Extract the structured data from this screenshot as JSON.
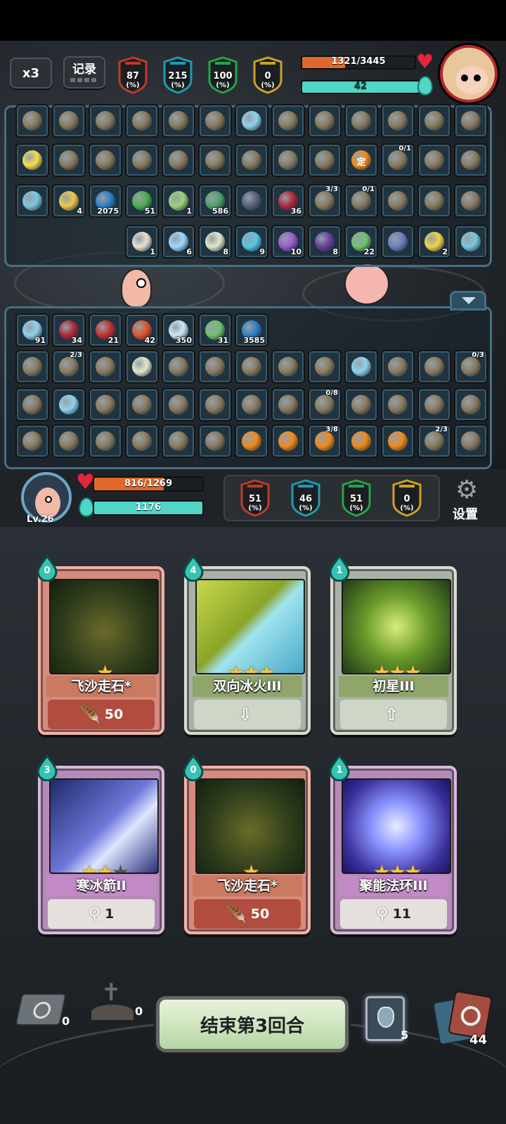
{
  "top_bar": {
    "speed_label": "x3",
    "record_label": "记录",
    "enemy_stats": [
      {
        "name": "attack",
        "value": "87",
        "unit": "(%)",
        "color": "#c0392b"
      },
      {
        "name": "crit",
        "value": "215",
        "unit": "(%)",
        "color": "#1f9bb0"
      },
      {
        "name": "defense",
        "value": "100",
        "unit": "(%)",
        "color": "#27a34a"
      },
      {
        "name": "ward",
        "value": "0",
        "unit": "(%)",
        "color": "#c9a227"
      }
    ],
    "enemy_hp": {
      "text": "1321/3445",
      "current": 1321,
      "max": 3445
    },
    "enemy_mana": {
      "text": "42",
      "fraction": 1.0
    }
  },
  "enemy_inventory": {
    "rows": [
      [
        {
          "icon": "crossbow-icon"
        },
        {
          "icon": "banana-sword-icon"
        },
        {
          "icon": "owl-icon"
        },
        {
          "icon": "gear-bomb-icon"
        },
        {
          "icon": "green-dagger-icon"
        },
        {
          "icon": "helmet-icon"
        },
        {
          "icon": "ghost-icon"
        },
        {
          "icon": "boot-icon"
        },
        {
          "icon": "bone-club-icon"
        },
        {
          "icon": "frog-pot-icon"
        },
        {
          "icon": "slime-icon"
        },
        {
          "icon": "meat-icon"
        },
        {
          "icon": "pig-icon"
        }
      ],
      [
        {
          "icon": "sun-orb-icon"
        },
        {
          "icon": "berry-icon"
        },
        {
          "icon": "brush-icon"
        },
        {
          "icon": "staff-icon"
        },
        {
          "icon": "green-gem-icon"
        },
        {
          "icon": "blue-coin-icon"
        },
        {
          "icon": "barrel-icon"
        },
        {
          "icon": "hat-icon"
        },
        {
          "icon": "stump-icon"
        },
        {
          "icon": "fixed-coin-icon",
          "label": "定"
        },
        {
          "icon": "shell-icon",
          "frac": "0/1"
        },
        {
          "icon": "hammer-icon"
        },
        {
          "icon": "trap-icon"
        }
      ],
      [
        {
          "icon": "wind-icon"
        },
        {
          "icon": "candle-icon",
          "count": "4"
        },
        {
          "icon": "blue-shield-icon",
          "count": "2075"
        },
        {
          "icon": "poison-cloud-icon",
          "count": "51"
        },
        {
          "icon": "wing-icon",
          "count": "1"
        },
        {
          "icon": "green-ghost-icon",
          "count": "586"
        },
        {
          "icon": "dark-crystal-icon"
        },
        {
          "icon": "red-down-shield-icon",
          "count": "36"
        },
        {
          "icon": "spider-icon",
          "frac": "3/3"
        },
        {
          "icon": "boomerang-icon",
          "frac": "0/1"
        },
        {
          "icon": "blue-bird-icon"
        },
        {
          "icon": "potion-icon"
        },
        {
          "icon": "plant-icon"
        }
      ],
      [
        {
          "icon": "bone-icon",
          "count": "1"
        },
        {
          "icon": "lightning-icon",
          "count": "6"
        },
        {
          "icon": "scroll-icon",
          "count": "8"
        },
        {
          "icon": "blue-face-icon",
          "count": "9"
        },
        {
          "icon": "purple-hand-icon",
          "count": "10"
        },
        {
          "icon": "dark-hand-icon",
          "count": "8"
        },
        {
          "icon": "skull-icon",
          "count": "22"
        },
        {
          "icon": "rune-icon"
        },
        {
          "icon": "clover-icon",
          "count": "2"
        },
        {
          "icon": "wind-icon"
        }
      ]
    ]
  },
  "player_inventory": {
    "rows": [
      [
        {
          "icon": "ghost-icon",
          "count": "91"
        },
        {
          "icon": "red-down-shield-icon",
          "count": "34"
        },
        {
          "icon": "claw-icon",
          "count": "21"
        },
        {
          "icon": "flame-icon",
          "count": "42"
        },
        {
          "icon": "snowflake-icon",
          "count": "350"
        },
        {
          "icon": "skull-icon",
          "count": "31"
        },
        {
          "icon": "blue-shield-icon",
          "count": "3585"
        }
      ],
      [
        {
          "icon": "pot-icon"
        },
        {
          "icon": "sausage-icon",
          "frac": "2/3"
        },
        {
          "icon": "chili-icon"
        },
        {
          "icon": "scroll-icon"
        },
        {
          "icon": "plant-icon"
        },
        {
          "icon": "banana-sword-icon"
        },
        {
          "icon": "gear-bomb-icon"
        },
        {
          "icon": "blue-card-icon"
        },
        {
          "icon": "cookie-icon"
        },
        {
          "icon": "ghost-icon"
        },
        {
          "icon": "sack-icon"
        },
        {
          "icon": "meat-stick-icon"
        },
        {
          "icon": "spider-icon",
          "frac": "0/3"
        }
      ],
      [
        {
          "icon": "owl-icon"
        },
        {
          "icon": "ghost-icon"
        },
        {
          "icon": "torch-icon"
        },
        {
          "icon": "bone-club-icon"
        },
        {
          "icon": "stump-icon"
        },
        {
          "icon": "scarecrow-icon"
        },
        {
          "icon": "hourglass-icon"
        },
        {
          "icon": "frog-pot-icon"
        },
        {
          "icon": "green-dagger-icon",
          "frac": "0/8"
        },
        {
          "icon": "whip-icon"
        },
        {
          "icon": "hat-icon"
        },
        {
          "icon": "blue-sword-icon"
        },
        {
          "icon": "meat-icon"
        }
      ],
      [
        {
          "icon": "rune-dragon-icon"
        },
        {
          "icon": "rune-cracks-icon"
        },
        {
          "icon": "yin-yang-icon"
        },
        {
          "icon": "rune-figure-icon"
        },
        {
          "icon": "rune-helmet-icon"
        },
        {
          "icon": "rune-monk-icon"
        },
        {
          "icon": "arrow-up-badge-icon"
        },
        {
          "icon": "arrow-up-badge-icon"
        },
        {
          "icon": "arrow-up-badge-icon",
          "frac": "3/8"
        },
        {
          "icon": "arrow-up-badge-icon"
        },
        {
          "icon": "arrow-up-badge-icon"
        },
        {
          "icon": "statue-icon",
          "frac": "2/3"
        },
        {
          "icon": "ham-icon"
        }
      ]
    ]
  },
  "player": {
    "level": "Lv.26",
    "hp": {
      "text": "816/1269",
      "current": 816,
      "max": 1269
    },
    "mana": {
      "text": "1176",
      "fraction": 1.0
    },
    "stats": [
      {
        "name": "attack",
        "value": "51",
        "unit": "(%)",
        "color": "#c0392b"
      },
      {
        "name": "crit",
        "value": "46",
        "unit": "(%)",
        "color": "#1f9bb0"
      },
      {
        "name": "defense",
        "value": "51",
        "unit": "(%)",
        "color": "#27a34a"
      },
      {
        "name": "ward",
        "value": "0",
        "unit": "(%)",
        "color": "#c9a227"
      }
    ],
    "settings_label": "设置"
  },
  "hand": {
    "cards": [
      {
        "name": "飞沙走石*",
        "cost": "0",
        "stars": 1,
        "max_stars": 1,
        "footer_value": "50",
        "footer_icon": "feather-icon",
        "theme": "red",
        "art": "bells-art"
      },
      {
        "name": "双向冰火III",
        "cost": "4",
        "stars": 3,
        "max_stars": 3,
        "footer_value": "",
        "footer_icon": "arrow-down-icon",
        "theme": "green",
        "art": "ice-fire-art"
      },
      {
        "name": "初星III",
        "cost": "1",
        "stars": 3,
        "max_stars": 3,
        "footer_value": "",
        "footer_icon": "arrow-up-icon",
        "theme": "green",
        "art": "star-art"
      },
      {
        "name": "寒冰箭II",
        "cost": "3",
        "stars": 2,
        "max_stars": 3,
        "footer_value": "1",
        "footer_icon": "staff-icon",
        "theme": "purple",
        "art": "ice-arrow-art"
      },
      {
        "name": "飞沙走石*",
        "cost": "0",
        "stars": 1,
        "max_stars": 1,
        "footer_value": "50",
        "footer_icon": "feather-icon",
        "theme": "red",
        "art": "bells-art"
      },
      {
        "name": "聚能法环III",
        "cost": "1",
        "stars": 3,
        "max_stars": 3,
        "footer_value": "11",
        "footer_icon": "staff-icon",
        "theme": "purple",
        "art": "ring-art"
      }
    ]
  },
  "bottom_bar": {
    "discard_count": "0",
    "grave_count": "0",
    "end_turn_label": "结束第3回合",
    "potion_count": "5",
    "deck_count": "44"
  },
  "colors": {
    "hp_fill": "#e0682c",
    "mana_fill": "#4fd6c7",
    "panel_border": "#466f85",
    "end_button": "#c9e4b5"
  }
}
